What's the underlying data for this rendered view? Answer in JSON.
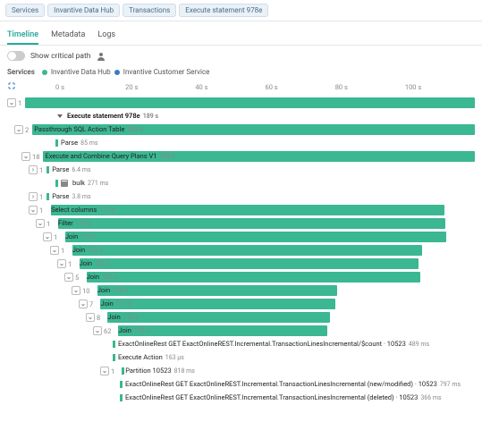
{
  "breadcrumbs": [
    "Services",
    "Invantive Data Hub",
    "Transactions",
    "Execute statement 978e"
  ],
  "tabs": {
    "timeline": "Timeline",
    "metadata": "Metadata",
    "logs": "Logs"
  },
  "controls": {
    "critical_path": "Show critical path"
  },
  "legend": {
    "label": "Services",
    "s1": "Invantive Data Hub",
    "s2": "Invantive Customer Service"
  },
  "ruler": {
    "t0": "0 s",
    "t1": "20 s",
    "t2": "40 s",
    "t3": "60 s",
    "t4": "80 s",
    "t5": "100 s"
  },
  "spans": {
    "root": {
      "label": "Execute statement 978e",
      "time": "189 s"
    },
    "pass": {
      "label": "Passthrough SQL Action Table",
      "time": "189 s"
    },
    "parse1": {
      "label": "Parse",
      "time": "85 ms"
    },
    "exec": {
      "label": "Execute and Combine Query Plans V1",
      "time": "188 s"
    },
    "parse2": {
      "label": "Parse",
      "time": "6.4 ms"
    },
    "bulk": {
      "label": "bulk",
      "time": "271 ms"
    },
    "parse3": {
      "label": "Parse",
      "time": "3.8 ms"
    },
    "select": {
      "label": "Select columns",
      "time": "173 s"
    },
    "filter": {
      "label": "Filter",
      "time": "173 s"
    },
    "join1": {
      "label": "Join",
      "time": "173 s"
    },
    "join2": {
      "label": "Join",
      "time": "162 s"
    },
    "join3": {
      "label": "Join",
      "time": "161 s"
    },
    "join4": {
      "label": "Join",
      "time": "160 s"
    },
    "join5": {
      "label": "Join",
      "time": "119 s"
    },
    "join6": {
      "label": "Join",
      "time": "117 s"
    },
    "join7": {
      "label": "Join",
      "time": "113 s"
    },
    "join8": {
      "label": "Join",
      "time": "110 s"
    },
    "rest1": {
      "label": "ExactOnlineRest GET ExactOnlineREST.Incremental.TransactionLinesIncremental/$count · 10523",
      "time": "489 ms"
    },
    "execa": {
      "label": "Execute Action",
      "time": "163 µs"
    },
    "part": {
      "label": "Partition 10523",
      "time": "818 ms"
    },
    "rest2": {
      "label": "ExactOnlineRest GET ExactOnlineREST.Incremental.TransactionLinesIncremental (new/modified) · 10523",
      "time": "797 ms"
    },
    "rest3": {
      "label": "ExactOnlineRest GET ExactOnlineREST.Incremental.TransactionLinesIncremental (deleted) · 10523",
      "time": "366 ms"
    }
  },
  "counts": {
    "c1": "1",
    "c2": "2",
    "c18": "18",
    "c1b": "1",
    "c1c": "1",
    "c1d": "1",
    "c1e": "1",
    "c1f": "1",
    "c1g": "1",
    "c5": "5",
    "c10": "10",
    "c7": "7",
    "c8": "8",
    "c62": "62",
    "c1p": "1"
  }
}
